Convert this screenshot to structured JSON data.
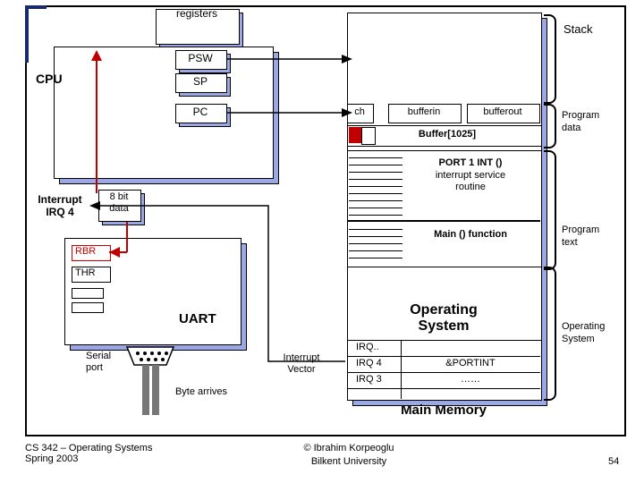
{
  "header": {
    "registers": "registers"
  },
  "cpu": {
    "title": "CPU",
    "psw": "PSW",
    "sp": "SP",
    "pc": "PC"
  },
  "interrupt": {
    "label": "Interrupt",
    "irq": "IRQ 4"
  },
  "uart": {
    "data_label": "8 bit\ndata",
    "rbr": "RBR",
    "thr": "THR",
    "title": "UART",
    "serial_port": "Serial\nport",
    "byte_arrives": "Byte arrives"
  },
  "memory": {
    "stack": "Stack",
    "ch": "ch",
    "bufferin": "bufferin",
    "bufferout": "bufferout",
    "buffer1025": "Buffer[1025]",
    "port1int": "PORT 1 INT ()",
    "isr": "interrupt service\nroutine",
    "main": "Main () function",
    "os_title1": "Operating",
    "os_title2": "System",
    "ivec_label": "Interrupt\nVector",
    "irq_top": "IRQ..",
    "irq4": "IRQ 4",
    "irq3": "IRQ 3",
    "portint_handler": "&PORTINT",
    "dots": "……",
    "main_mem": "Main Memory",
    "program_data": "Program\ndata",
    "program_text": "Program\ntext",
    "os_side": "Operating\nSystem"
  },
  "footer": {
    "course": "CS 342 – Operating Systems",
    "term": "Spring 2003",
    "credit1": "© Ibrahim Korpeoglu",
    "credit2": "Bilkent University",
    "pagenum": "54"
  }
}
